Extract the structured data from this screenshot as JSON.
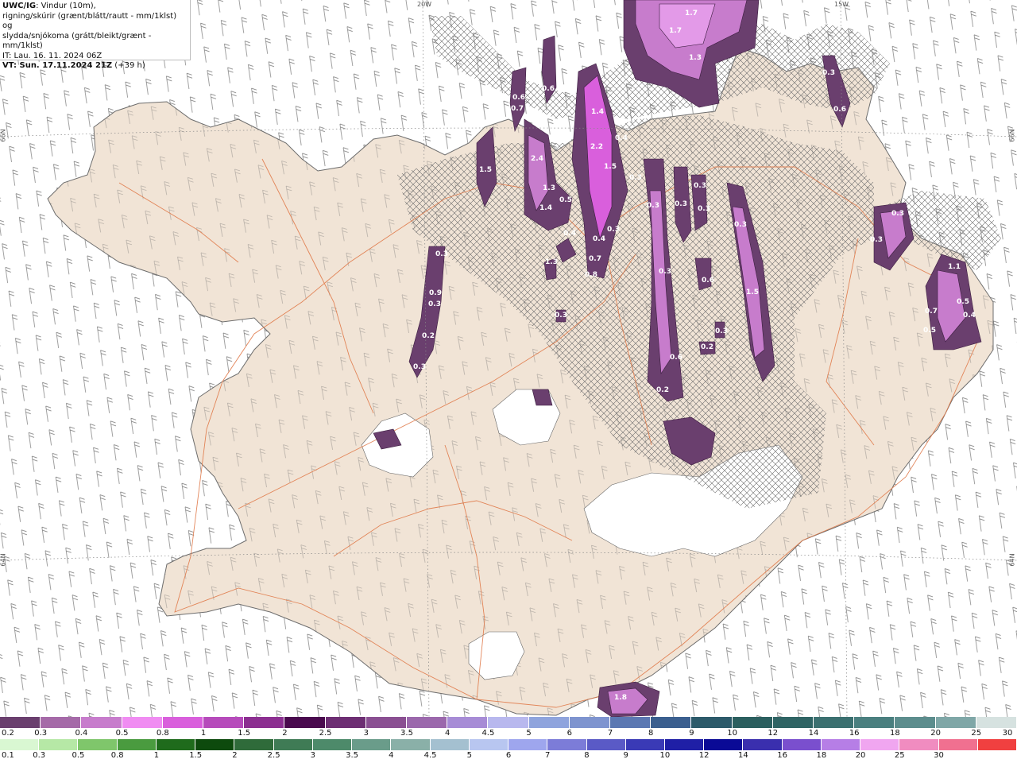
{
  "header": {
    "product": "UWC/IG",
    "line1_rest": ": Vindur (10m),",
    "line2": "rigning/skúrir (grænt/blátt/rautt - mm/1klst) og",
    "line3": "slydda/snjókoma (grátt/bleikt/grænt - mm/1klst)",
    "line4": "IT: Lau. 16. 11. 2024 06Z",
    "line5_bold": "VT: Sun. 17.11.2024 21Z",
    "line5_rest": " (+39 h)"
  },
  "graticule": {
    "top_left_lon": "20W",
    "top_right_lon": "15W",
    "left_lat_top": "66N",
    "left_lat_bottom": "64N",
    "right_lat_top": "66N",
    "right_lat_bottom": "64N"
  },
  "map_labels": [
    "1.7",
    "1.7",
    "1.3",
    "0.3",
    "0.6",
    "0.6",
    "0.7",
    "0.6",
    "1.4",
    "2.4",
    "2.2",
    "1.5",
    "0.4",
    "1.5",
    "1.3",
    "1.4",
    "0.5",
    "0.4",
    "0.4",
    "0.3",
    "0.7",
    "0.8",
    "0.3",
    "0.3",
    "0.3",
    "0.3",
    "0.3",
    "0.3",
    "0.3",
    "0.6",
    "1.3",
    "0.3",
    "0.3",
    "0.9",
    "0.3",
    "1.5",
    "0.2",
    "0.6",
    "0.3",
    "0.3",
    "0.3",
    "0.2",
    "0.3",
    "0.2",
    "1.1",
    "0.7",
    "0.5",
    "0.5",
    "0.4",
    "1.8"
  ],
  "snow_scale": {
    "colors": [
      "#6a3f6e",
      "#a56aa8",
      "#c77ccc",
      "#f08cf2",
      "#d95fdc",
      "#b64bbb",
      "#8c2f91",
      "#4a0a4e",
      "#6d2e73",
      "#8a4f92",
      "#9b68ac",
      "#a78cd6",
      "#b8b8ee",
      "#8fa4dd",
      "#7e94cf",
      "#5b78b2",
      "#3b5f8f",
      "#2c5a6a",
      "#2b5f5f",
      "#2f6464",
      "#3b7070",
      "#4a7f7f",
      "#5c8d8d",
      "#7fa7a7",
      "#d6e2e0"
    ],
    "labels": [
      "0.2",
      "0.3",
      "0.4",
      "0.5",
      "0.8",
      "1",
      "1.5",
      "2",
      "2.5",
      "3",
      "3.5",
      "4",
      "4.5",
      "5",
      "6",
      "7",
      "8",
      "9",
      "10",
      "12",
      "14",
      "16",
      "18",
      "20",
      "25",
      "30"
    ]
  },
  "rain_scale": {
    "colors": [
      "#d9f7d2",
      "#b6e8a6",
      "#7fc66b",
      "#4a9b3f",
      "#1f6b1c",
      "#0d4a0d",
      "#2f6b3a",
      "#3f7b55",
      "#4d8a6a",
      "#6a9c8a",
      "#8ab0a8",
      "#a4c0d0",
      "#b8c6f0",
      "#9ea6ee",
      "#7c7cd8",
      "#5a5ac6",
      "#3a3ab6",
      "#1f1fa6",
      "#0a0a96",
      "#3a2fae",
      "#7a4fce",
      "#b67ee6",
      "#f0a6f0",
      "#f08cc0",
      "#f07090",
      "#f04040"
    ],
    "labels": [
      "0.1",
      "0.3",
      "0.5",
      "0.8",
      "1",
      "1.5",
      "2",
      "2.5",
      "3",
      "3.5",
      "4",
      "4.5",
      "5",
      "6",
      "7",
      "8",
      "9",
      "10",
      "12",
      "14",
      "16",
      "18",
      "20",
      "25",
      "30"
    ]
  }
}
